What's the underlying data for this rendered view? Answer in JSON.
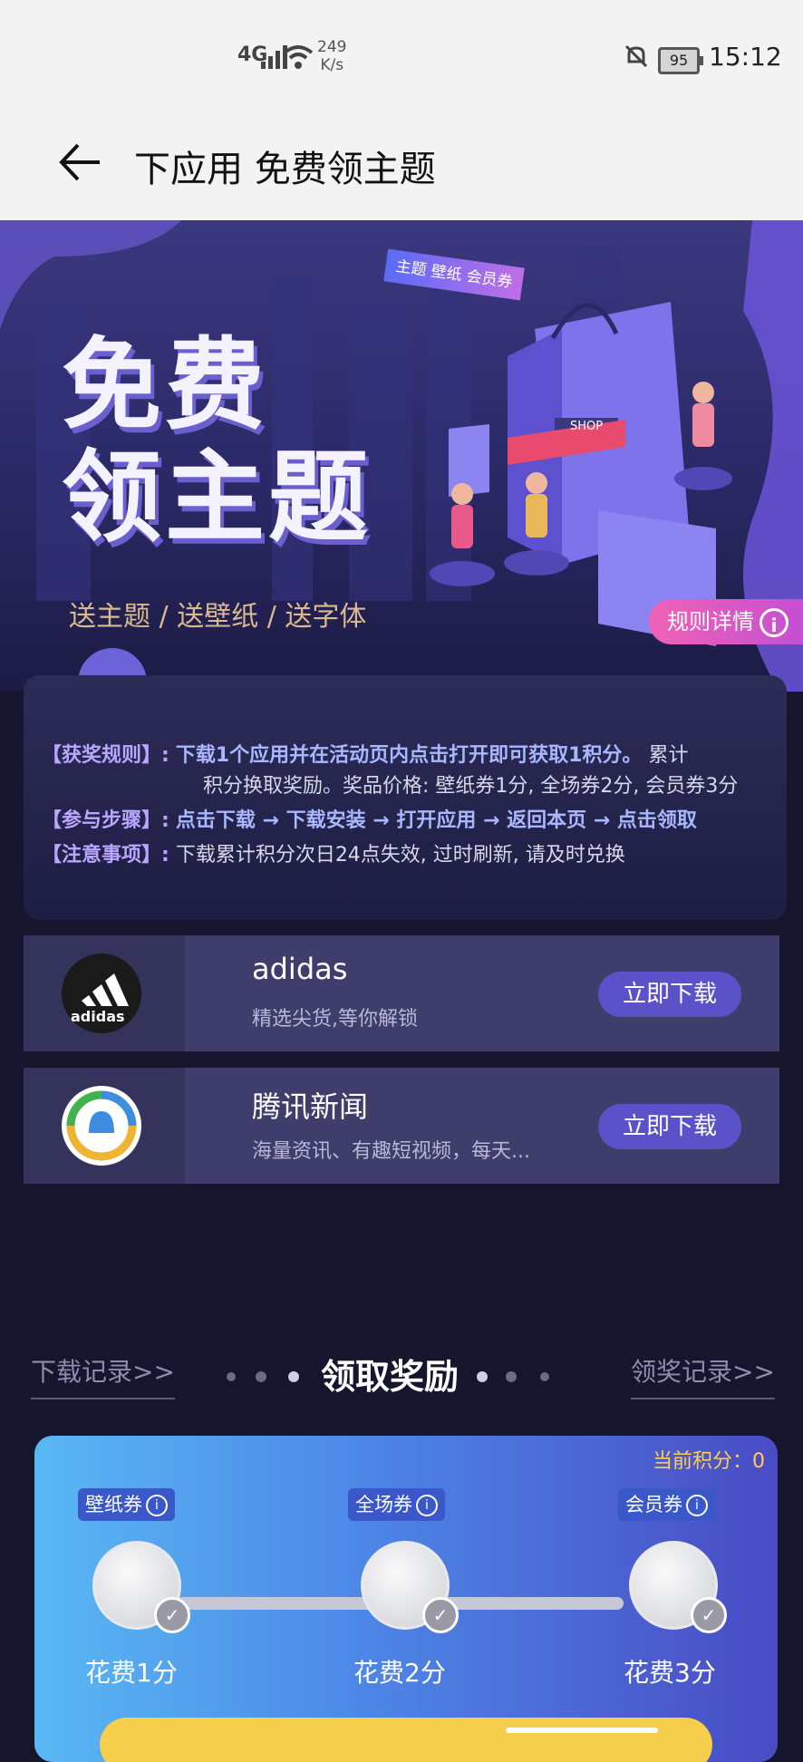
{
  "status": {
    "signal": "4G",
    "net_speed": "249",
    "net_unit": "K/s",
    "battery": "95",
    "time": "15:12"
  },
  "header": {
    "title": "下应用 免费领主题"
  },
  "hero": {
    "big_line1": "免费",
    "big_line2": "领主题",
    "banner": "主题 壁纸 会员券",
    "shop_sign": "SHOP",
    "subtitle": "送主题 / 送壁纸 / 送字体",
    "rule_detail": "规则详情"
  },
  "rules": {
    "award_key": "【获奖规则】:",
    "award_highlight": "下载1个应用并在活动页内点击打开即可获取1积分。",
    "award_rest1": "累计",
    "award_rest2": "积分换取奖励。奖品价格: 壁纸券1分, 全场券2分, 会员券3分",
    "steps_key": "【参与步骤】:",
    "steps": "点击下载 → 下载安装 → 打开应用 → 返回本页 → 点击领取",
    "notes_key": "【注意事项】:",
    "notes": "下载累计积分次日24点失效, 过时刷新, 请及时兑换"
  },
  "apps": [
    {
      "name": "adidas",
      "desc": "精选尖货,等你解锁",
      "button": "立即下载",
      "logo_text": "adidas"
    },
    {
      "name": "腾讯新闻",
      "desc": "海量资讯、有趣短视频，每天...",
      "button": "立即下载"
    }
  ],
  "rewards": {
    "download_records": "下载记录>>",
    "title": "领取奖励",
    "prize_records": "领奖记录>>",
    "points": "当前积分：0",
    "tiers": [
      {
        "name": "壁纸券",
        "cost": "花费1分"
      },
      {
        "name": "全场券",
        "cost": "花费2分"
      },
      {
        "name": "会员券",
        "cost": "花费3分"
      }
    ]
  },
  "colors": {
    "accent_purple": "#5b51c9",
    "gold": "#ffcf4a",
    "pink": "#f062b6"
  }
}
